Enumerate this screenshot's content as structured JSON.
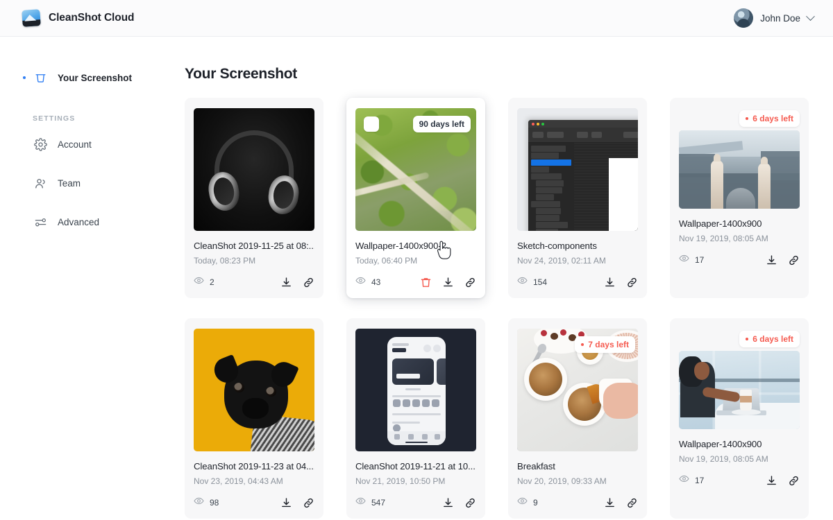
{
  "header": {
    "brand": "CleanShot Cloud",
    "logo_icon": "cleanshot-logo-icon",
    "user_name": "John Doe",
    "chevron_icon": "chevron-down-icon",
    "avatar_icon": "avatar"
  },
  "sidebar": {
    "primary": {
      "label": "Your Screenshot",
      "icon": "bucket-icon",
      "active": true
    },
    "section_label": "SETTINGS",
    "items": [
      {
        "label": "Account",
        "icon": "gear-icon"
      },
      {
        "label": "Team",
        "icon": "people-icon"
      },
      {
        "label": "Advanced",
        "icon": "sliders-icon"
      }
    ]
  },
  "main": {
    "title": "Your Screenshot",
    "action_icons": {
      "views": "eye-icon",
      "download": "download-icon",
      "link": "link-icon",
      "delete": "trash-icon"
    },
    "cards": [
      {
        "title": "CleanShot 2019-11-25 at 08:...",
        "date": "Today, 08:23 PM",
        "views": "2",
        "badge": null,
        "hovered": false,
        "thumb": "headphones"
      },
      {
        "title": "Wallpaper-1400x900-2",
        "date": "Today, 06:40 PM",
        "views": "43",
        "badge": {
          "text": "90 days left",
          "style": "neutral",
          "position": "inside"
        },
        "hovered": true,
        "checkbox": true,
        "thumb": "forest"
      },
      {
        "title": "Sketch-components",
        "date": "Nov 24, 2019, 02:11 AM",
        "views": "154",
        "badge": null,
        "hovered": false,
        "thumb": "sketch"
      },
      {
        "title": "Wallpaper-1400x900",
        "date": "Nov 19, 2019, 08:05 AM",
        "views": "17",
        "badge": {
          "text": "6 days left",
          "style": "expiring",
          "position": "above"
        },
        "hovered": false,
        "thumb": "city"
      },
      {
        "title": "CleanShot 2019-11-23 at 04....",
        "date": "Nov 23, 2019, 04:43 AM",
        "views": "98",
        "badge": null,
        "hovered": false,
        "thumb": "pug"
      },
      {
        "title": "CleanShot 2019-11-21 at 10....",
        "date": "Nov 21, 2019, 10:50 PM",
        "views": "547",
        "badge": null,
        "hovered": false,
        "thumb": "phone"
      },
      {
        "title": "Breakfast",
        "date": "Nov 20, 2019, 09:33 AM",
        "views": "9",
        "badge": {
          "text": "7 days left",
          "style": "expiring",
          "position": "inside"
        },
        "hovered": false,
        "thumb": "breakfast"
      },
      {
        "title": "Wallpaper-1400x900",
        "date": "Nov 19, 2019, 08:05 AM",
        "views": "17",
        "badge": {
          "text": "6 days left",
          "style": "expiring",
          "position": "above"
        },
        "hovered": false,
        "thumb": "cafe"
      }
    ]
  },
  "colors": {
    "accent": "#2f7ef3",
    "danger": "#f55b50",
    "card_bg": "#f7f7f8",
    "text": "#1d2129",
    "muted": "#8b929b"
  }
}
